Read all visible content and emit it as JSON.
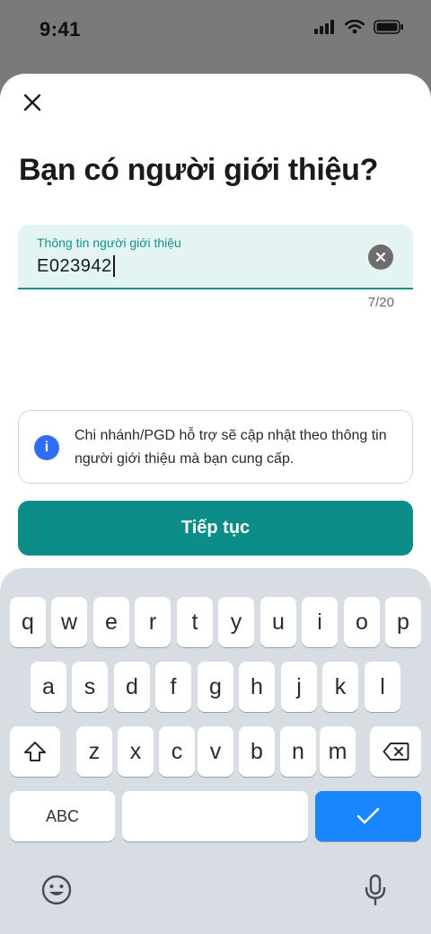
{
  "status": {
    "time": "9:41"
  },
  "sheet": {
    "title": "Bạn có người giới thiệu?",
    "field": {
      "label": "Thông tin người giới thiệu",
      "value": "E023942"
    },
    "counter": "7/20",
    "info": "Chi nhánh/PGD hỗ trợ sẽ cập nhật theo thông tin người giới thiệu mà bạn cung cấp.",
    "cta": "Tiếp tục"
  },
  "keyboard": {
    "row1": [
      "q",
      "w",
      "e",
      "r",
      "t",
      "y",
      "u",
      "i",
      "o",
      "p"
    ],
    "row2": [
      "a",
      "s",
      "d",
      "f",
      "g",
      "h",
      "j",
      "k",
      "l"
    ],
    "row3": [
      "z",
      "x",
      "c",
      "v",
      "b",
      "n",
      "m"
    ],
    "abc": "ABC"
  }
}
